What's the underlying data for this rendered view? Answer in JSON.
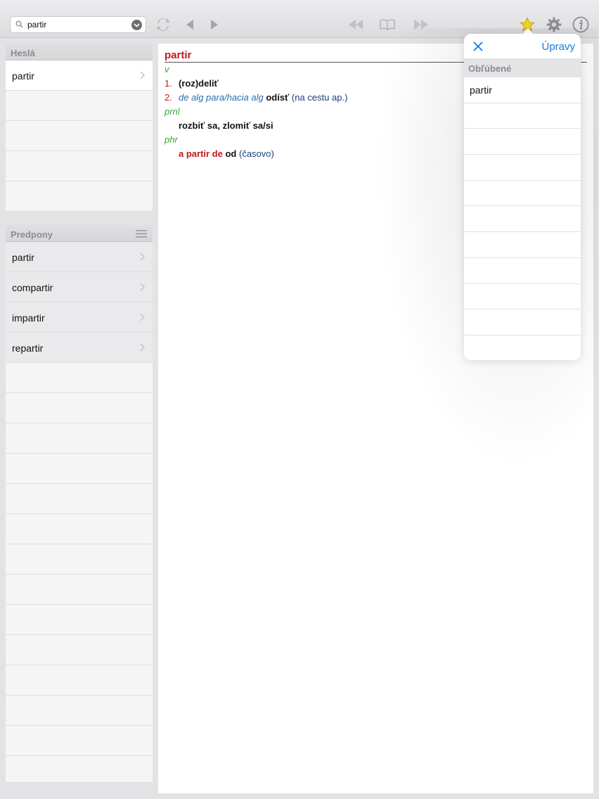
{
  "toolbar": {
    "search_value": "partir",
    "icons": [
      "search-icon",
      "dropdown-icon",
      "sync-icon",
      "back-icon",
      "forward-icon",
      "history-back-icon",
      "book-icon",
      "history-forward-icon",
      "star-icon",
      "gear-icon",
      "info-icon"
    ]
  },
  "hesla": {
    "header": "Heslá",
    "items": [
      "partir"
    ]
  },
  "predpony": {
    "header": "Predpony",
    "items": [
      "partir",
      "compartir",
      "impartir",
      "repartir"
    ]
  },
  "entry": {
    "headword": "partir",
    "pos_v": "v",
    "sense1_num": "1.",
    "sense1_text": "(roz)deliť",
    "sense2_num": "2.",
    "sense2_phrase": "de alg para/hacia alg",
    "sense2_trans": "odísť",
    "sense2_note": "(na cestu ap.)",
    "pos_prnl": "prnl",
    "prnl_text": "rozbiť sa, zlomiť sa/si",
    "pos_phr": "phr",
    "phr_phrase": "a partir de",
    "phr_trans": "od",
    "phr_note": "(časovo)"
  },
  "favorites": {
    "edit_label": "Úpravy",
    "header": "Obľúbené",
    "items": [
      "partir"
    ]
  },
  "colors": {
    "headword": "#c4161c",
    "pos": "#3aa63a",
    "link_blue": "#1a7ad6",
    "star": "#f2d21b"
  }
}
